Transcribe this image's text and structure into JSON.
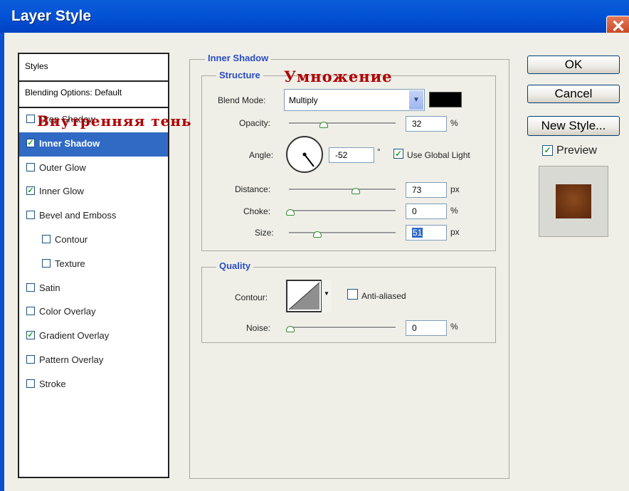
{
  "window": {
    "title": "Layer Style",
    "close_glyph": "✕"
  },
  "styles_panel": {
    "header": "Styles",
    "blending_options": "Blending Options: Default",
    "items": [
      {
        "label": "Drop Shadow",
        "checked": false,
        "selected": false,
        "indent": false
      },
      {
        "label": "Inner Shadow",
        "checked": true,
        "selected": true,
        "indent": false
      },
      {
        "label": "Outer Glow",
        "checked": false,
        "selected": false,
        "indent": false
      },
      {
        "label": "Inner Glow",
        "checked": true,
        "selected": false,
        "indent": false
      },
      {
        "label": "Bevel and Emboss",
        "checked": false,
        "selected": false,
        "indent": false
      },
      {
        "label": "Contour",
        "checked": false,
        "selected": false,
        "indent": true
      },
      {
        "label": "Texture",
        "checked": false,
        "selected": false,
        "indent": true
      },
      {
        "label": "Satin",
        "checked": false,
        "selected": false,
        "indent": false
      },
      {
        "label": "Color Overlay",
        "checked": false,
        "selected": false,
        "indent": false
      },
      {
        "label": "Gradient Overlay",
        "checked": true,
        "selected": false,
        "indent": false
      },
      {
        "label": "Pattern Overlay",
        "checked": false,
        "selected": false,
        "indent": false
      },
      {
        "label": "Stroke",
        "checked": false,
        "selected": false,
        "indent": false
      }
    ]
  },
  "inner_shadow": {
    "section_title": "Inner Shadow",
    "structure_title": "Structure",
    "blend_mode_label": "Blend Mode:",
    "blend_mode_value": "Multiply",
    "shadow_color": "#000000",
    "opacity_label": "Opacity:",
    "opacity_value": "32",
    "opacity_unit": "%",
    "angle_label": "Angle:",
    "angle_value": "-52",
    "angle_unit": "°",
    "use_global_light_label": "Use Global Light",
    "use_global_light_checked": true,
    "distance_label": "Distance:",
    "distance_value": "73",
    "distance_unit": "px",
    "choke_label": "Choke:",
    "choke_value": "0",
    "choke_unit": "%",
    "size_label": "Size:",
    "size_value": "51",
    "size_unit": "px"
  },
  "quality": {
    "title": "Quality",
    "contour_label": "Contour:",
    "anti_aliased_label": "Anti-aliased",
    "anti_aliased_checked": false,
    "noise_label": "Noise:",
    "noise_value": "0",
    "noise_unit": "%"
  },
  "buttons": {
    "ok": "OK",
    "cancel": "Cancel",
    "new_style": "New Style...",
    "preview_label": "Preview",
    "preview_checked": true
  },
  "annotations": {
    "multiply": "Умножение",
    "inner_shadow": "Внутренняя тень"
  },
  "colors": {
    "title_bar": "#0453d6",
    "selected_item": "#316ac5",
    "group_title": "#2a4dc4",
    "annotation": "#b00000",
    "preview_fill": "#7a3a16"
  }
}
